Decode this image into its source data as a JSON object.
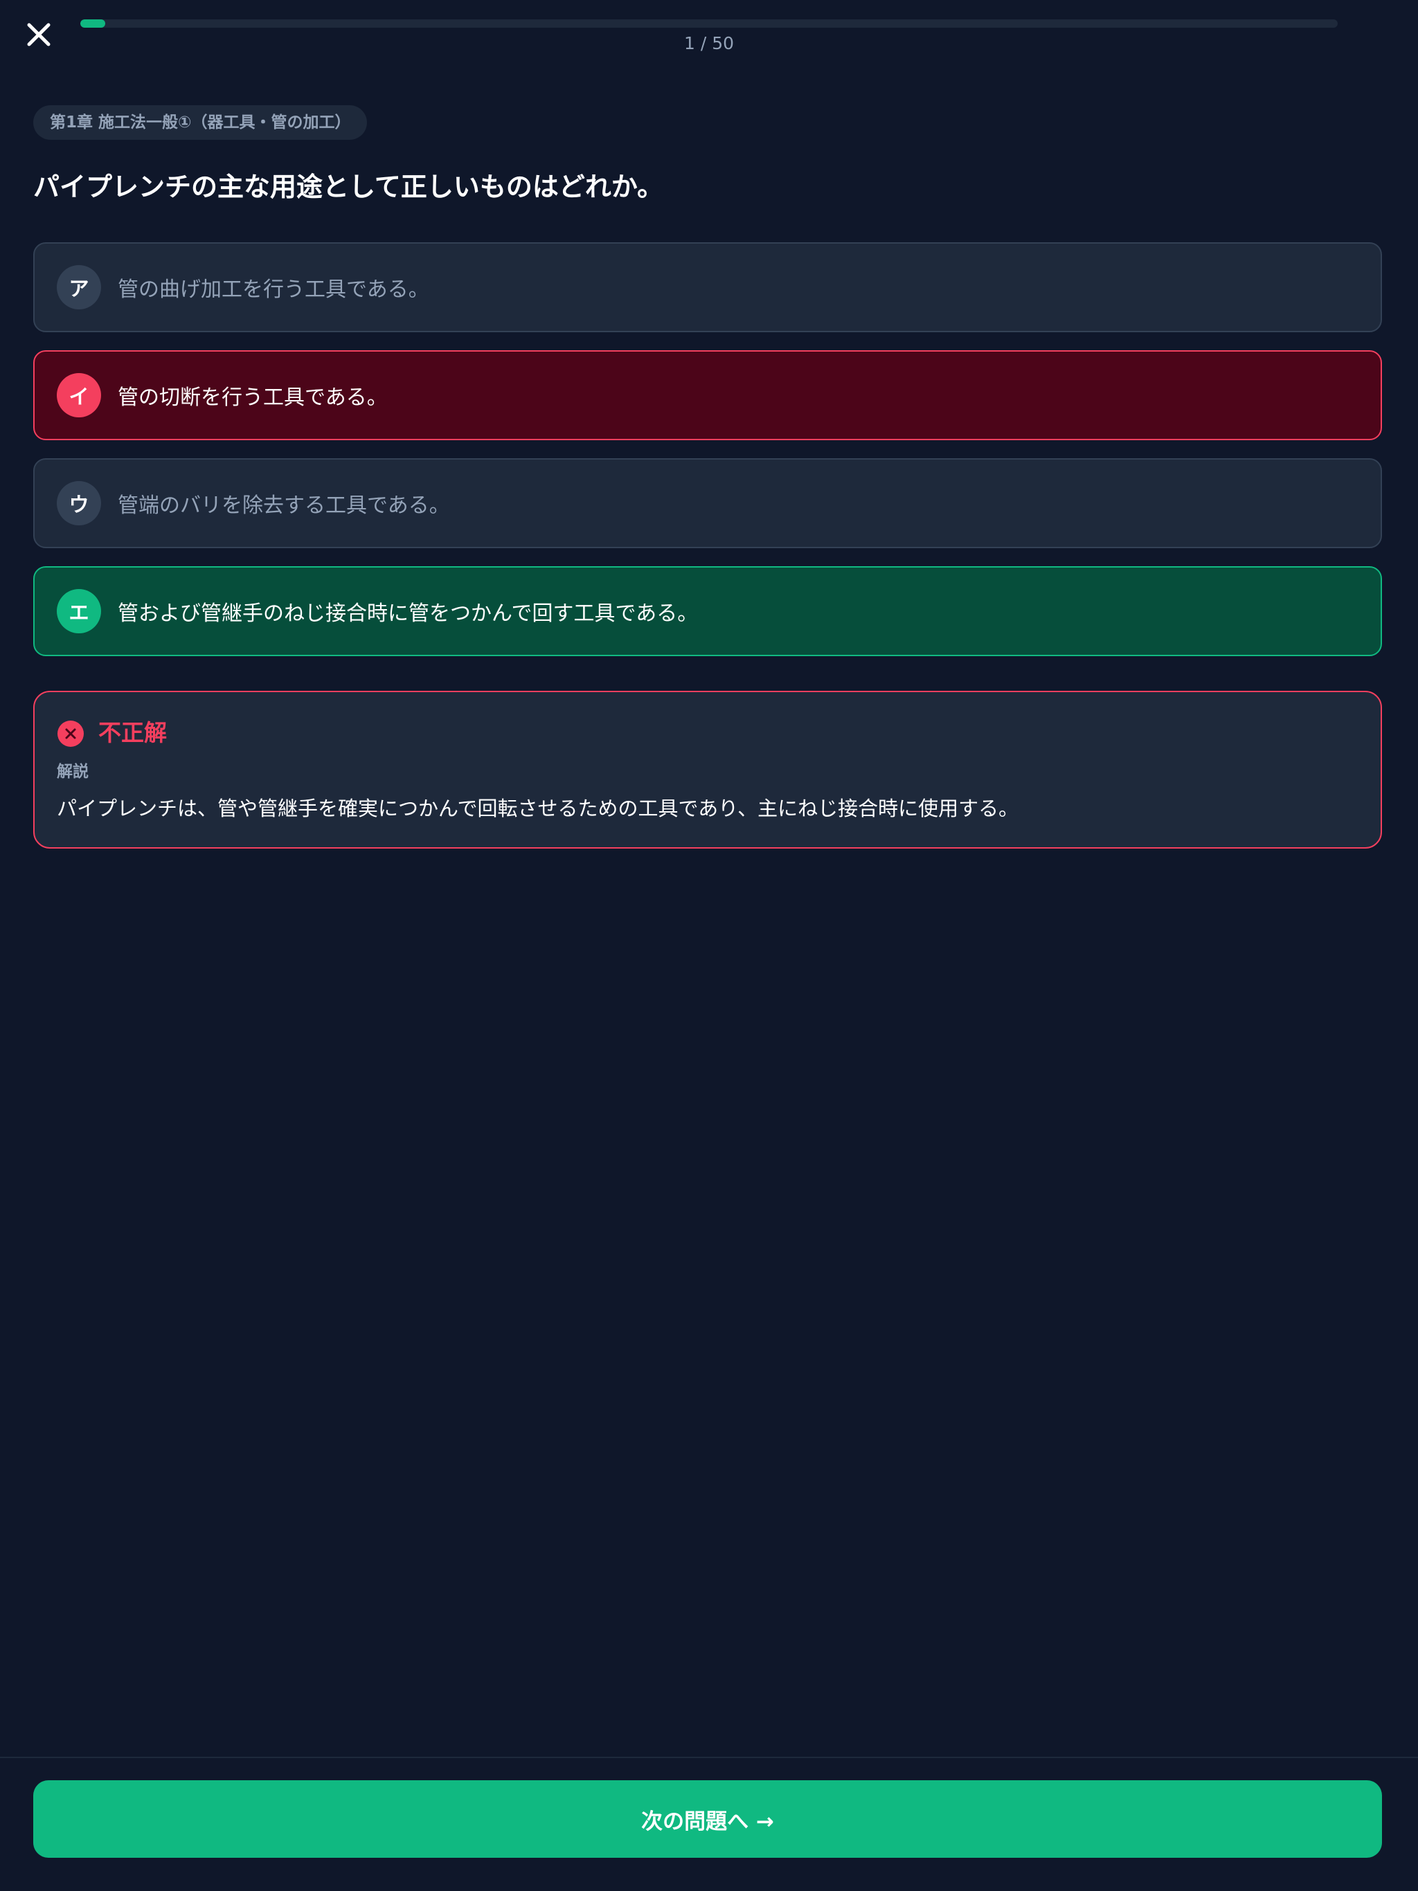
{
  "header": {
    "close_icon": "close-icon",
    "progress": {
      "current": 1,
      "total": 50,
      "label": "1 / 50",
      "fraction": 0.02
    }
  },
  "question": {
    "chapter": "第1章 施工法一般①（器工具・管の加工）",
    "text": "パイプレンチの主な用途として正しいものはどれか。",
    "options": [
      {
        "marker": "ア",
        "text": "管の曲げ加工を行う工具である。",
        "state": "neutral"
      },
      {
        "marker": "イ",
        "text": "管の切断を行う工具である。",
        "state": "selected-wrong"
      },
      {
        "marker": "ウ",
        "text": "管端のバリを除去する工具である。",
        "state": "neutral"
      },
      {
        "marker": "エ",
        "text": "管および管継手のねじ接合時に管をつかんで回す工具である。",
        "state": "correct"
      }
    ]
  },
  "result": {
    "icon": "x-circle-icon",
    "title": "不正解",
    "explanation_label": "解説",
    "explanation": "パイプレンチは、管や管継手を確実につかんで回転させるための工具であり、主にねじ接合時に使用する。"
  },
  "footer": {
    "next_label": "次の問題へ →"
  },
  "colors": {
    "background": "#0f172a",
    "card": "#1e293b",
    "accent_green": "#10b981",
    "accent_red": "#f43f5e",
    "muted_text": "#94a3b8"
  }
}
